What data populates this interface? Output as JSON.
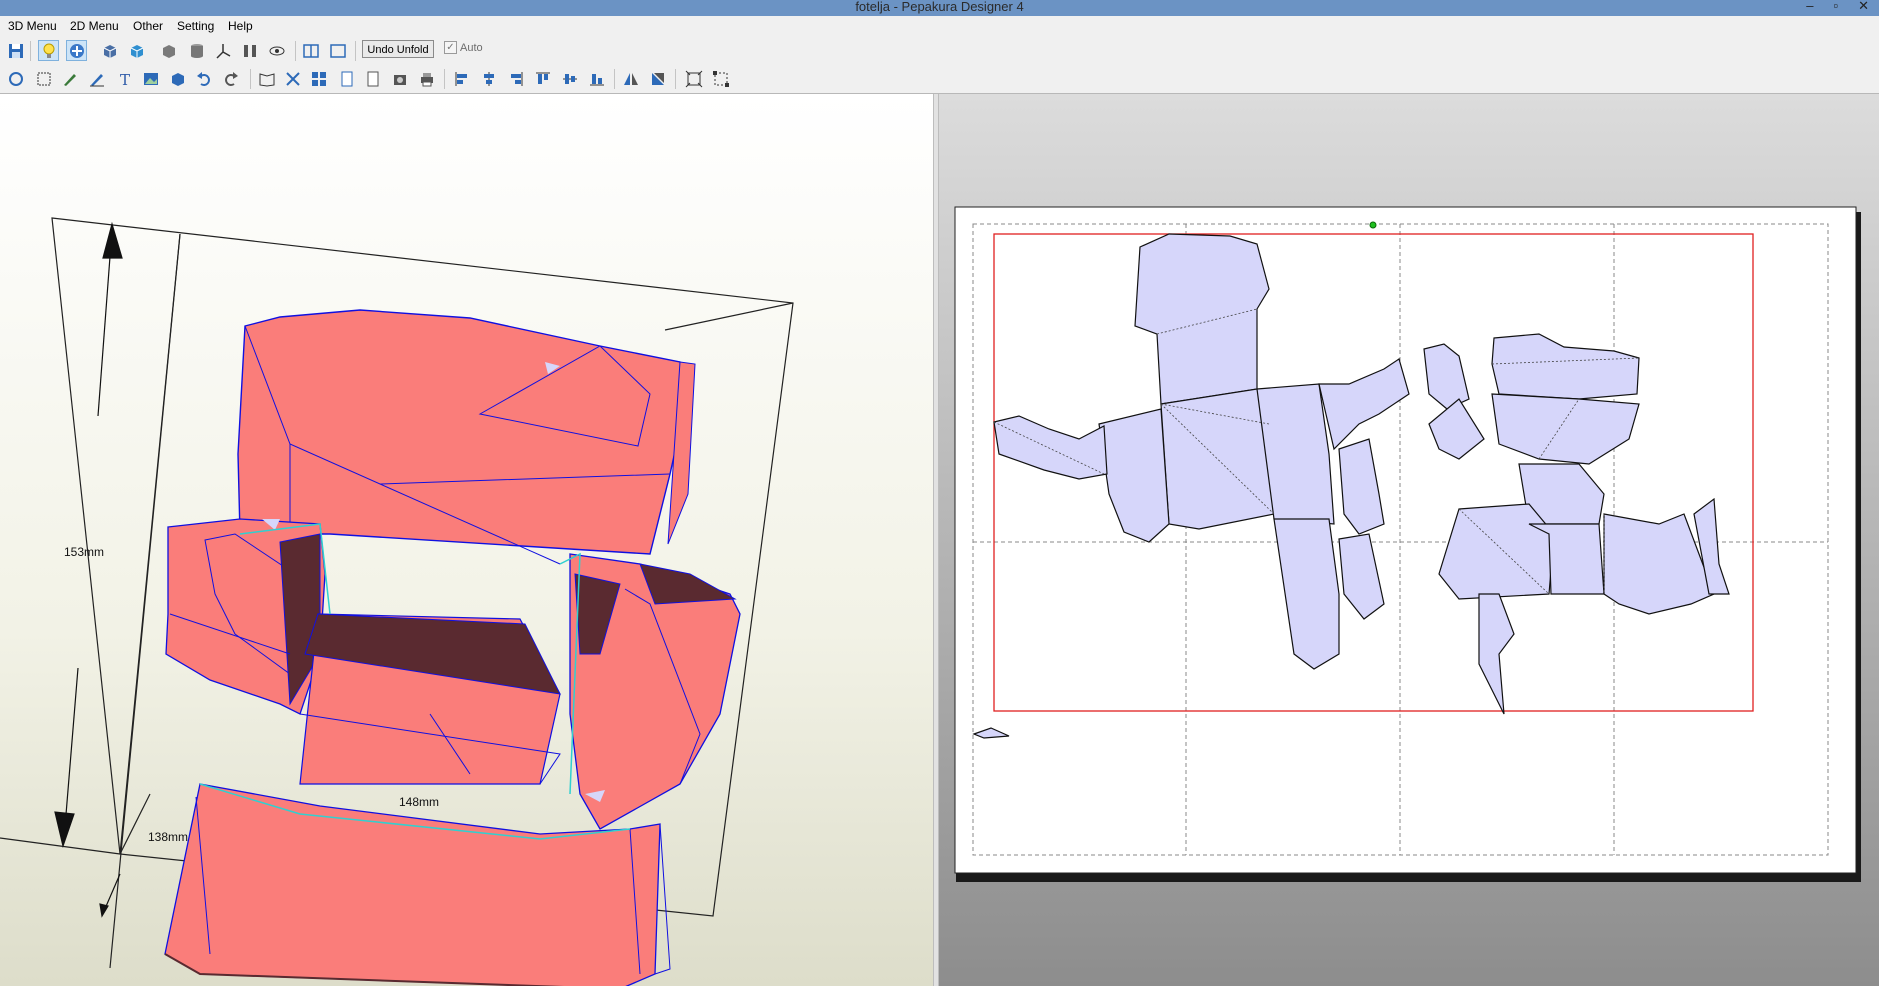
{
  "window": {
    "title": "fotelja  - Pepakura Designer 4"
  },
  "menu": [
    "3D Menu",
    "2D Menu",
    "Other",
    "Setting",
    "Help"
  ],
  "toolbar": {
    "undo_unfold": "Undo Unfold",
    "auto_label": "Auto",
    "auto_checked": true
  },
  "view3d": {
    "dim_height": "153mm",
    "dim_width": "148mm",
    "dim_depth": "138mm",
    "model_color": "#fa7d7a",
    "edge_color": "#1010e0"
  },
  "view2d": {
    "part_color": "#d6d6fa"
  }
}
